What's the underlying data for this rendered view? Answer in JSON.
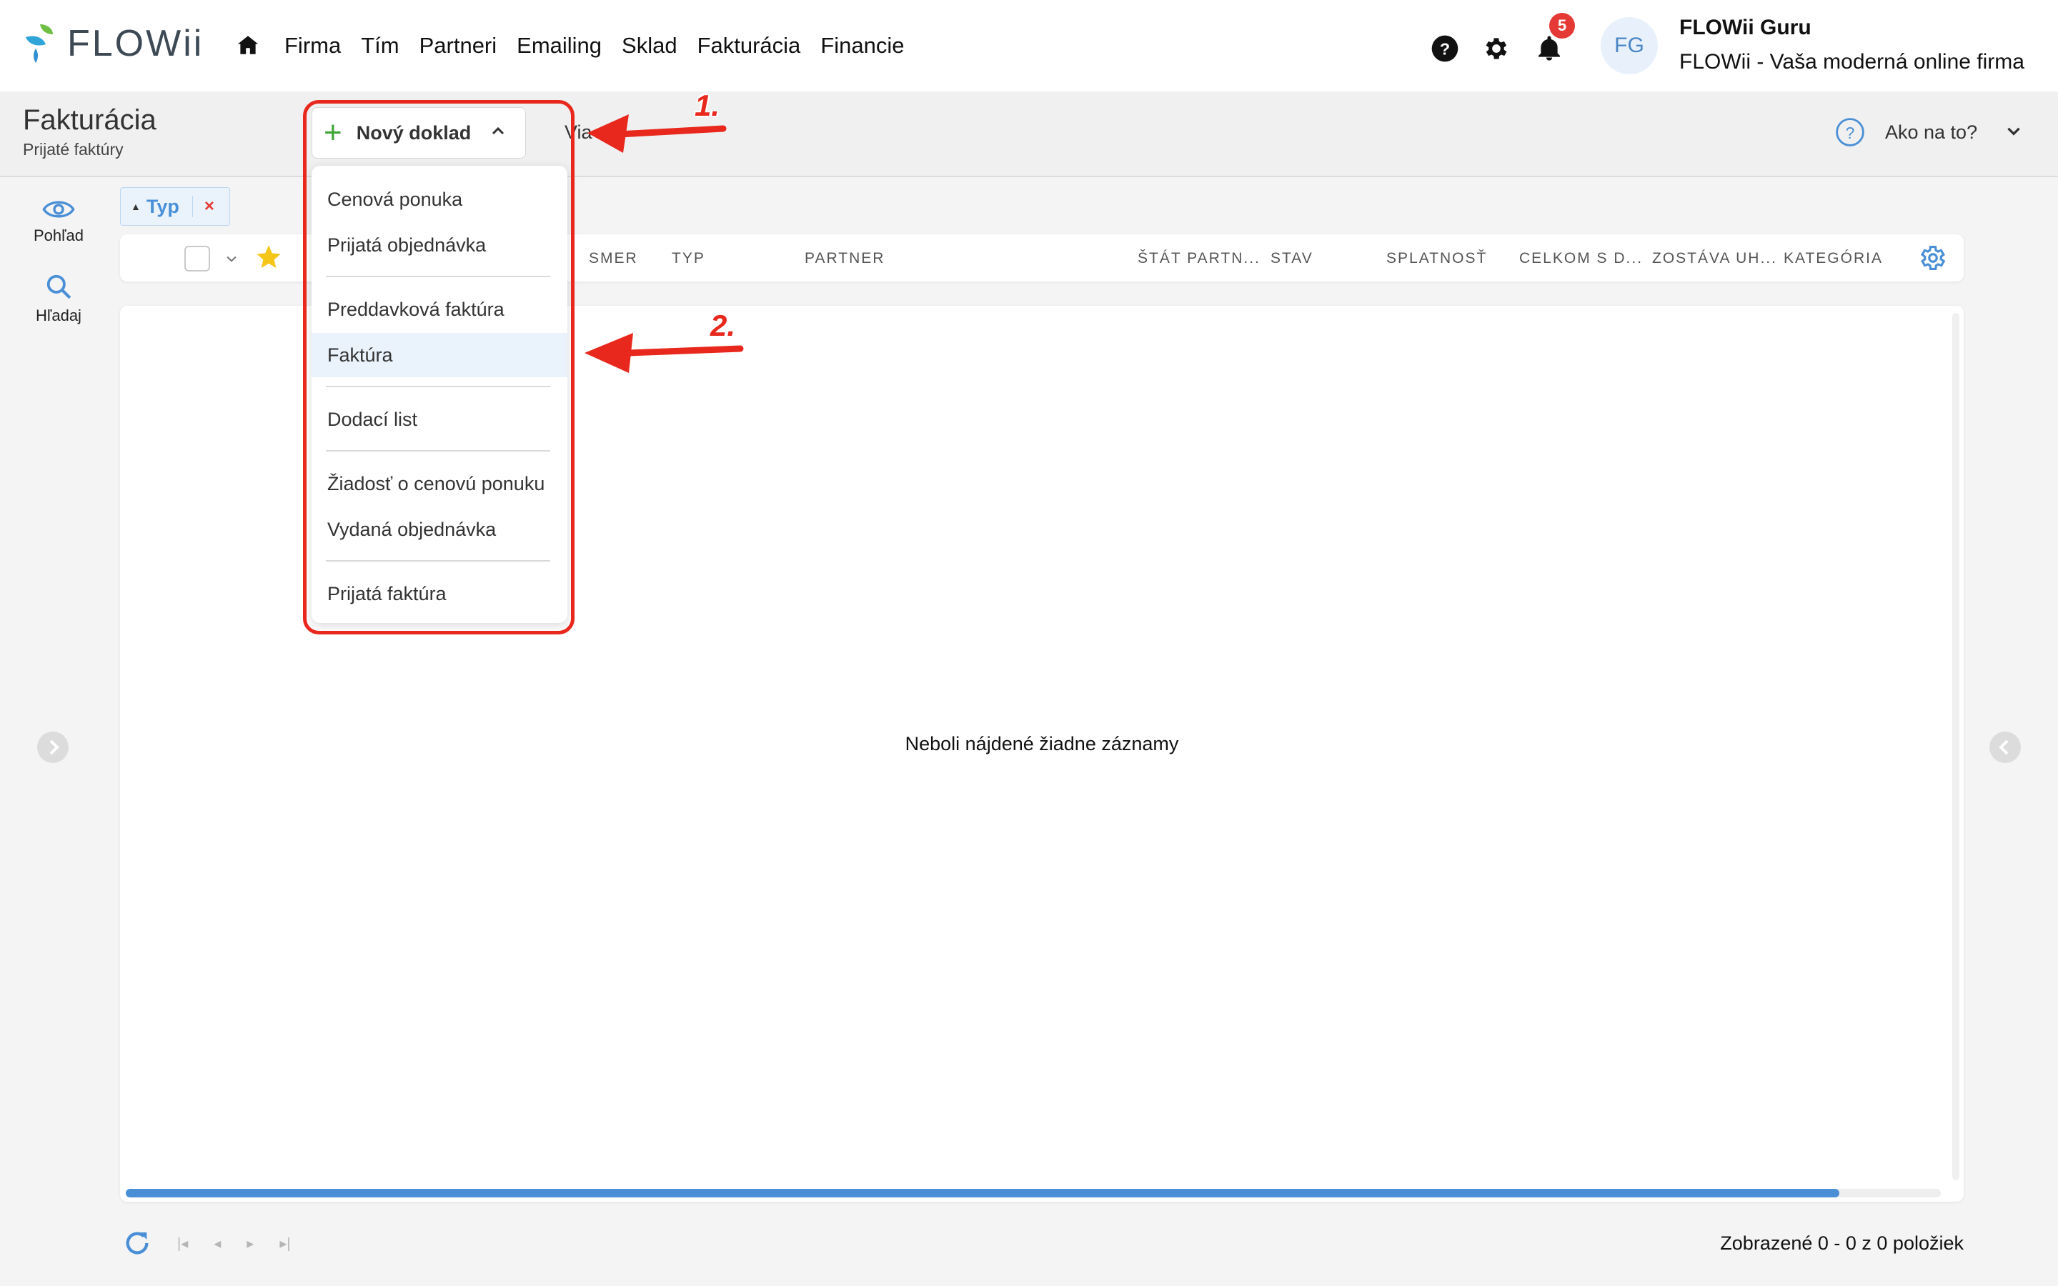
{
  "app": {
    "logo_text": "FLOWii",
    "nav": [
      "Firma",
      "Tím",
      "Partneri",
      "Emailing",
      "Sklad",
      "Fakturácia",
      "Financie"
    ],
    "notifications_count": "5",
    "user_initials": "FG",
    "user_name": "FLOWii Guru",
    "company_name": "FLOWii - Vaša moderná online firma"
  },
  "header": {
    "title": "Fakturácia",
    "subtitle": "Prijaté faktúry",
    "new_doc_label": "Nový doklad",
    "more_label": "Via",
    "help_label": "Ako na to?"
  },
  "rail": {
    "view_label": "Pohľad",
    "search_label": "Hľadaj"
  },
  "filter": {
    "label": "Typ"
  },
  "table": {
    "columns": [
      "SMER",
      "TYP",
      "PARTNER",
      "ŠTÁT PARTN...",
      "STAV",
      "SPLATNOSŤ",
      "CELKOM S D...",
      "ZOSTÁVA UH...",
      "KATEGÓRIA"
    ],
    "empty_message": "Neboli nájdené žiadne záznamy"
  },
  "footer": {
    "count_text": "Zobrazené 0 - 0 z 0 položiek"
  },
  "dropdown": {
    "items": [
      "Cenová ponuka",
      "Prijatá objednávka",
      "Preddavková faktúra",
      "Faktúra",
      "Dodací list",
      "Žiadosť o cenovú ponuku",
      "Vydaná objednávka",
      "Prijatá faktúra"
    ],
    "active_index": 3
  },
  "annotations": {
    "step1": "1.",
    "step2": "2."
  },
  "colors": {
    "accent_blue": "#4a8fd6",
    "annotation_red": "#e8281c",
    "plus_green": "#3fa535",
    "badge_red": "#e53935"
  }
}
